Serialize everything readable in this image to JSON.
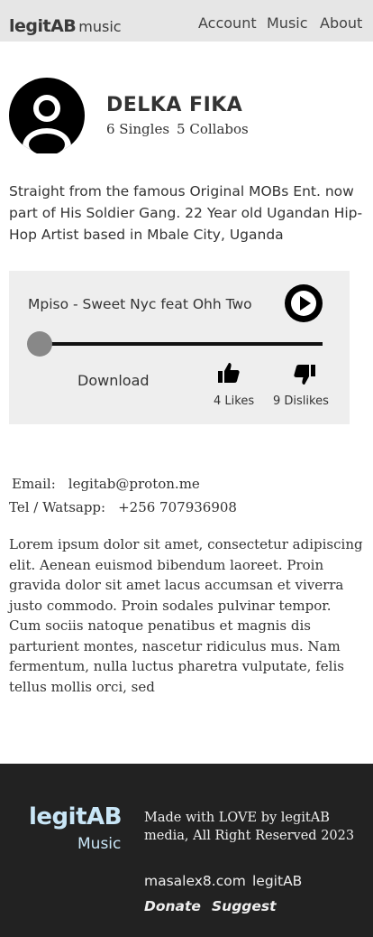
{
  "header": {
    "brand_bold": "legitAB",
    "brand_light": "music",
    "nav": [
      "Account",
      "Music",
      "About"
    ]
  },
  "artist": {
    "avatar_icon": "user-circle-icon",
    "name": "DELKA FIKA",
    "singles": "6 Singles",
    "collabos": "5 Collabos",
    "bio": "Straight from the famous Original MOBs Ent. now part of His Soldier Gang. 22 Year old Ugandan Hip-Hop Artist based in Mbale City, Uganda"
  },
  "player": {
    "track_title": "Mpiso - Sweet Nyc feat Ohh Two",
    "play_icon": "play-circle-icon",
    "progress": 0,
    "download_label": "Download",
    "like_icon": "thumbs-up-icon",
    "dislike_icon": "thumbs-down-icon",
    "likes": "4 Likes",
    "dislikes": "9 Dislikes"
  },
  "contact": {
    "email_label": "Email:",
    "email_value": "legitab@proton.me",
    "tel_label": "Tel / Watsapp:",
    "tel_value": "+256 707936908"
  },
  "description": "Lorem ipsum dolor sit amet, consectetur adipiscing elit. Aenean euismod bibendum laoreet. Proin gravida dolor sit amet lacus accumsan et viverra justo commodo. Proin sodales pulvinar tempor. Cum sociis natoque penatibus et magnis dis parturient montes, nascetur ridiculus mus. Nam fermentum, nulla luctus pharetra vulputate, felis tellus mollis orci, sed",
  "footer": {
    "logo_main": "legitAB",
    "logo_sub": "Music",
    "credit": "Made with LOVE by legitAB media,  All Right Reserved 2023",
    "site_link": "masalex8.com",
    "legit_link": "legitAB",
    "donate": "Donate",
    "suggest": "Suggest"
  },
  "colors": {
    "header_bg": "#e6e6e6",
    "player_bg": "#eeeeee",
    "footer_bg": "#222222",
    "footer_logo": "#c9e6f7"
  }
}
